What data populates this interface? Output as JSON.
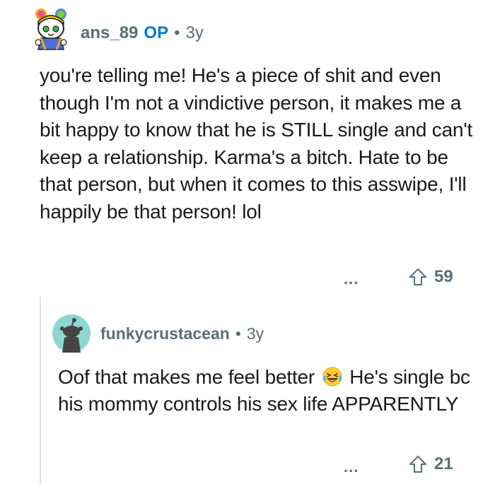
{
  "comment": {
    "username": "ans_89",
    "op_badge": "OP",
    "separator": "•",
    "age": "3y",
    "text": "you're telling me! He's a piece of shit and even though I'm not a vindictive person, it makes me a bit happy to know that he is STILL single and can't keep a relationship. Karma's a bitch. Hate to be that person, but when it comes to this asswipe, I'll happily be that person! lol",
    "more_label": "...",
    "upvotes": "59",
    "avatar_icon": "snoo-avatar-colorful",
    "upvote_icon": "upvote-arrow-icon"
  },
  "reply": {
    "username": "funkycrustacean",
    "separator": "•",
    "age": "3y",
    "text_before_emoji": "Oof that makes me feel better",
    "emoji": "laughing-tears-emoji",
    "text_after_emoji": "He's single bc his mommy controls his sex life APPARENTLY",
    "more_label": "...",
    "upvotes": "21",
    "avatar_icon": "default-snoo-avatar",
    "upvote_icon": "upvote-arrow-icon"
  },
  "colors": {
    "meta_gray": "#576f76",
    "op_blue": "#0079d3",
    "avatar_teal": "#8fd6d2",
    "thread_line": "#dcdfe1"
  }
}
